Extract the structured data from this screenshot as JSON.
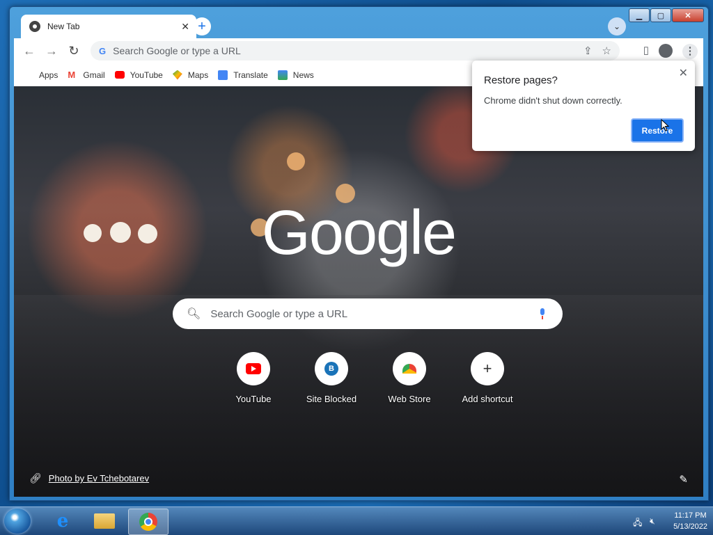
{
  "window": {
    "tab_title": "New Tab",
    "tab_close": "✕",
    "new_tab": "+",
    "minimize": "▁",
    "maximize": "▢",
    "close": "✕"
  },
  "toolbar": {
    "omnibox_placeholder": "Search Google or type a URL"
  },
  "bookmarks": [
    {
      "label": "Apps",
      "icon": "apps-icon"
    },
    {
      "label": "Gmail",
      "icon": "gmail-icon"
    },
    {
      "label": "YouTube",
      "icon": "youtube-icon"
    },
    {
      "label": "Maps",
      "icon": "maps-icon"
    },
    {
      "label": "Translate",
      "icon": "translate-icon"
    },
    {
      "label": "News",
      "icon": "news-icon"
    }
  ],
  "ntp": {
    "logo": "Google",
    "search_placeholder": "Search Google or type a URL",
    "shortcuts": [
      {
        "label": "YouTube",
        "icon": "youtube-icon"
      },
      {
        "label": "Site Blocked",
        "icon": "b-letter-icon"
      },
      {
        "label": "Web Store",
        "icon": "webstore-icon"
      },
      {
        "label": "Add shortcut",
        "icon": "plus-icon"
      }
    ],
    "photo_credit": "Photo by Ev Tchebotarev"
  },
  "popup": {
    "title": "Restore pages?",
    "message": "Chrome didn't shut down correctly.",
    "button": "Restore"
  },
  "taskbar": {
    "time": "11:17 PM",
    "date": "5/13/2022"
  },
  "colors": {
    "accent": "#1a73e8",
    "taskbar": "#2a5a90"
  }
}
